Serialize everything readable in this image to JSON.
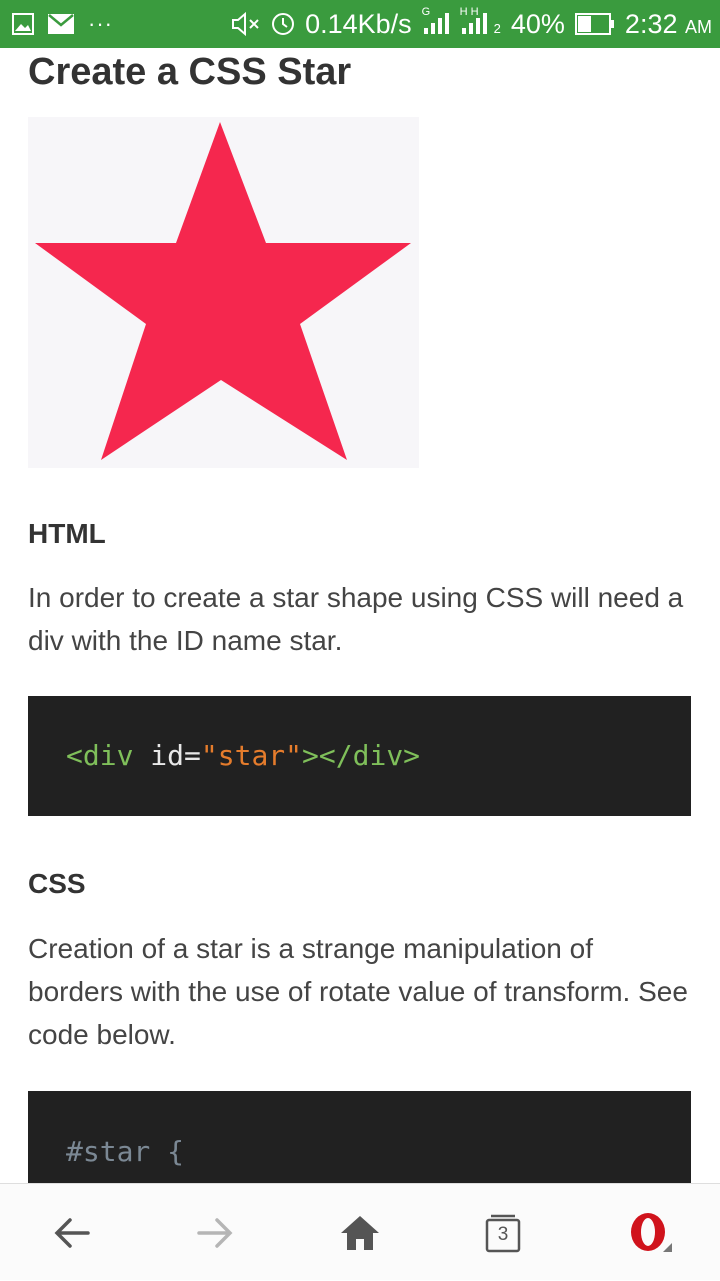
{
  "status_bar": {
    "speed": "0.14Kb/s",
    "sim1_label": "G",
    "sim2_label": "H H",
    "sim_slot": "2",
    "battery": "40%",
    "time": "2:32",
    "ampm": "AM",
    "more": "···",
    "icons": [
      "gallery-icon",
      "mail-icon",
      "mute-icon",
      "alarm-icon",
      "signal-icon",
      "battery-icon"
    ]
  },
  "article": {
    "title": "Create a CSS Star",
    "star_color": "#f5274e",
    "html_heading": "HTML",
    "html_paragraph": "In order to create a star shape using CSS will need a div with the ID name star.",
    "html_code": {
      "open_tag": "<div",
      "attr": "id=",
      "value": "\"star\"",
      "close_tag": "></div>"
    },
    "css_heading": "CSS",
    "css_paragraph": "Creation of a star is a strange manipulation of borders with the use of rotate value of transform. See code below.",
    "css_code": {
      "line1": "#star {"
    }
  },
  "bottom_nav": {
    "tabs_count": "3",
    "icons": [
      "back-arrow-icon",
      "forward-arrow-icon",
      "home-icon",
      "tabs-icon",
      "opera-menu-icon"
    ]
  },
  "colors": {
    "status_bar": "#3a9b3e",
    "code_bg": "#212121",
    "code_tag": "#7fbf5a",
    "code_value": "#e57c2c",
    "opera_red": "#d0131c"
  }
}
